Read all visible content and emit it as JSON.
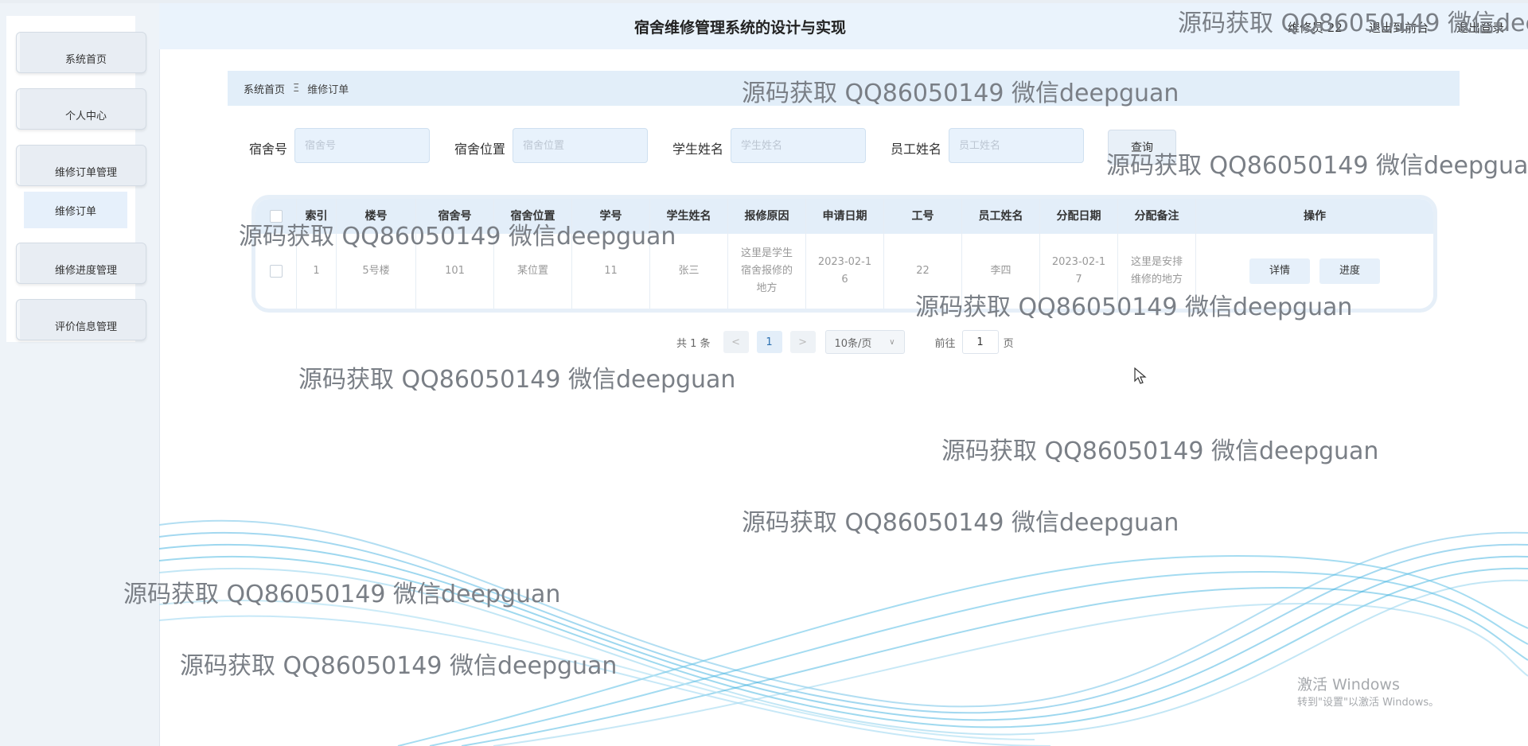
{
  "app": {
    "title": "宿舍维修管理系统的设计与实现",
    "user_label": "维修员 22",
    "front_link": "退出到前台",
    "logout_link": "退出登录"
  },
  "sidebar": {
    "items": [
      {
        "label": "系统首页"
      },
      {
        "label": "个人中心"
      },
      {
        "label": "维修订单管理"
      },
      {
        "label": "维修进度管理"
      },
      {
        "label": "评价信息管理"
      }
    ],
    "sub_item": "维修订单"
  },
  "breadcrumb": {
    "home": "系统首页",
    "separator": "Ξ",
    "current": "维修订单"
  },
  "search": {
    "fields": [
      {
        "label": "宿舍号",
        "placeholder": "宿舍号"
      },
      {
        "label": "宿舍位置",
        "placeholder": "宿舍位置"
      },
      {
        "label": "学生姓名",
        "placeholder": "学生姓名"
      },
      {
        "label": "员工姓名",
        "placeholder": "员工姓名"
      }
    ],
    "query_label": "查询"
  },
  "table": {
    "headers": [
      "索引",
      "楼号",
      "宿舍号",
      "宿舍位置",
      "学号",
      "学生姓名",
      "报修原因",
      "申请日期",
      "工号",
      "员工姓名",
      "分配日期",
      "分配备注",
      "操作"
    ],
    "rows": [
      {
        "cells": [
          "1",
          "5号楼",
          "101",
          "某位置",
          "11",
          "张三",
          "这里是学生宿舍报修的地方",
          "2023-02-16",
          "22",
          "李四",
          "2023-02-17",
          "这里是安排维修的地方"
        ],
        "actions": [
          "详情",
          "进度"
        ]
      }
    ]
  },
  "pagination": {
    "total": "共 1 条",
    "prev": "<",
    "current_page": "1",
    "next": ">",
    "page_size": "10条/页",
    "goto_label": "前往",
    "goto_value": "1",
    "page_unit": "页"
  },
  "watermark": {
    "text": "源码获取 QQ86050149 微信deepguan",
    "text_cut": "源码获取 QQ86050149 微信dee"
  },
  "windows": {
    "activate": "激活 Windows",
    "activate_sub": "转到\"设置\"以激活 Windows。"
  }
}
